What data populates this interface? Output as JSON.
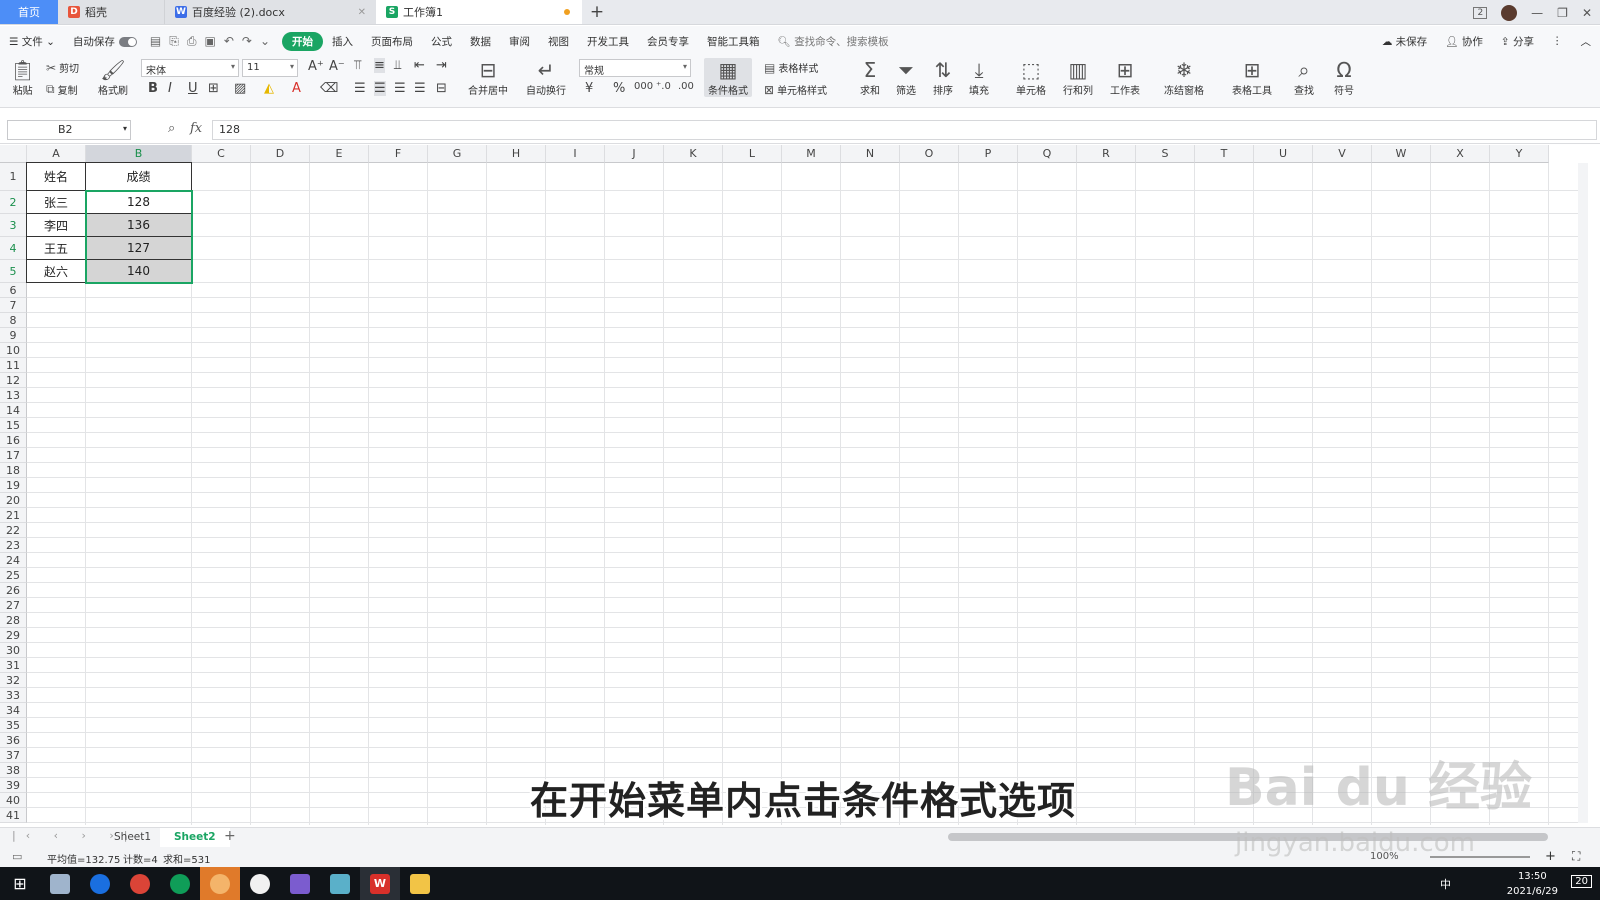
{
  "tabs": {
    "home": "首页",
    "t1": "稻壳",
    "t2": "百度经验 (2).docx",
    "t3": "工作簿1",
    "win_badge": "2"
  },
  "menu": {
    "file": "文件",
    "autosave": "自动保存",
    "items": [
      "开始",
      "插入",
      "页面布局",
      "公式",
      "数据",
      "审阅",
      "视图",
      "开发工具",
      "会员专享",
      "智能工具箱"
    ],
    "search": "查找命令、搜索模板",
    "unsaved": "未保存",
    "collab": "协作",
    "share": "分享"
  },
  "ribbon": {
    "paste": "粘贴",
    "cut": "剪切",
    "copy": "复制",
    "format_painter": "格式刷",
    "font": "宋体",
    "size": "11",
    "merge": "合并居中",
    "wrap": "自动换行",
    "numfmt": "常规",
    "cond": "条件格式",
    "table_style": "表格样式",
    "cell_style": "单元格样式",
    "sum": "求和",
    "filter": "筛选",
    "sort": "排序",
    "fill": "填充",
    "cell": "单元格",
    "rowcol": "行和列",
    "sheet": "工作表",
    "freeze": "冻结窗格",
    "tools": "表格工具",
    "find": "查找",
    "symbol": "符号"
  },
  "formula": {
    "namebox": "B2",
    "fx": "fx",
    "value": "128"
  },
  "grid": {
    "columns": [
      "A",
      "B",
      "C",
      "D",
      "E",
      "F",
      "G",
      "H",
      "I",
      "J",
      "K",
      "L",
      "M",
      "N",
      "O",
      "P",
      "Q",
      "R",
      "S",
      "T",
      "U",
      "V",
      "W",
      "X",
      "Y"
    ],
    "rows": [
      "1",
      "2",
      "3",
      "4",
      "5",
      "6",
      "7",
      "8",
      "9",
      "10",
      "11",
      "12",
      "13",
      "14",
      "15",
      "16",
      "17",
      "18",
      "19",
      "20",
      "21",
      "22",
      "23",
      "24",
      "25",
      "26",
      "27",
      "28",
      "29",
      "30",
      "31",
      "32",
      "33",
      "34",
      "35",
      "36",
      "37",
      "38",
      "39",
      "40",
      "41"
    ],
    "header": [
      "姓名",
      "成绩"
    ],
    "data": [
      [
        "张三",
        "128"
      ],
      [
        "李四",
        "136"
      ],
      [
        "王五",
        "127"
      ],
      [
        "赵六",
        "140"
      ]
    ]
  },
  "sheets": [
    "Sheet1",
    "Sheet2"
  ],
  "status": {
    "avg": "平均值=132.75",
    "count": "计数=4",
    "sum": "求和=531",
    "zoom": "100%"
  },
  "taskbar": {
    "time": "13:50",
    "date": "2021/6/29",
    "ime": "中",
    "notif": "20"
  },
  "subtitle": "在开始菜单内点击条件格式选项",
  "watermark": {
    "logo": "Bai du 经验",
    "url": "jingyan.baidu.com"
  },
  "colors": {
    "accent": "#1aa563",
    "tab_home": "#4d8ef7",
    "selected_fill": "#d5d5d5"
  }
}
